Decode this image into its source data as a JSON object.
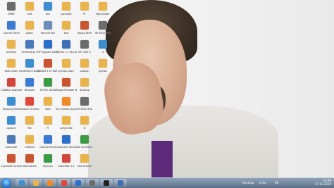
{
  "desktop_icons": [
    {
      "label": "HPBE",
      "color": "#6b6b6b"
    },
    {
      "label": "Control Panel",
      "color": "#3b7bd3"
    },
    {
      "label": "answers",
      "color": "#e9b44c"
    },
    {
      "label": "New folder",
      "color": "#e9b44c"
    },
    {
      "label": "CANDLE Aptitude",
      "color": "#d1473c"
    },
    {
      "label": "Shipping Rate",
      "color": "#3c8ed1"
    },
    {
      "label": "capture",
      "color": "#3c8ed1"
    },
    {
      "label": "Computer",
      "color": "#4a79b8"
    },
    {
      "label": "Cypress6 Screener",
      "color": "#c9542f"
    },
    {
      "label": "edit",
      "color": "#e9b44c"
    },
    {
      "label": "public",
      "color": "#e9b44c"
    },
    {
      "label": "Screenshot 1",
      "color": "#4a79b8"
    },
    {
      "label": "excited123 Download",
      "color": "#3c8ed1"
    },
    {
      "label": "Network",
      "color": "#3b7bd3"
    },
    {
      "label": "Google Chrome",
      "color": "#e0463a"
    },
    {
      "label": "file",
      "color": "#e9b44c"
    },
    {
      "label": "Untitled",
      "color": "#e9b44c"
    },
    {
      "label": "hibernation",
      "color": "#c9542f"
    },
    {
      "label": "SID",
      "color": "#3c8ed1"
    },
    {
      "label": "Recycle Bin",
      "color": "#6b8fb8"
    },
    {
      "label": "HP Support Assistant",
      "color": "#2a6fc9"
    },
    {
      "label": "INSIAM 1.0 HAIR 2.0",
      "color": "#c9542f"
    },
    {
      "label": "HOTEL XXXX",
      "color": "#3b9a45"
    },
    {
      "label": "note",
      "color": "#e9b44c"
    },
    {
      "label": "Pr",
      "color": "#e9b44c"
    },
    {
      "label": "Control Panel",
      "color": "#3b7bd3"
    },
    {
      "label": "SkyCam",
      "color": "#3b9a45"
    },
    {
      "label": "javanote",
      "color": "#e9b44c"
    },
    {
      "label": "test",
      "color": "#e9b44c"
    },
    {
      "label": "Python 3.7 (64-bit)",
      "color": "#3c6fb4"
    },
    {
      "label": "python.docx",
      "color": "#e9b44c"
    },
    {
      "label": "Reward Reader NC",
      "color": "#c9542f"
    },
    {
      "label": "VLC media player",
      "color": "#f08a24"
    },
    {
      "label": "script test",
      "color": "#e9b44c"
    },
    {
      "label": "CyberLink YouCam 10",
      "color": "#2a6fc9"
    },
    {
      "label": "StoreMan 1.4",
      "color": "#d1473c"
    },
    {
      "label": "Pr",
      "color": "#e9b44c"
    },
    {
      "label": "Happy Birth",
      "color": "#c9542f"
    },
    {
      "label": "IM 3000 X",
      "color": "#6b6b6b"
    },
    {
      "label": "session",
      "color": "#e9b44c"
    },
    {
      "label": "desktop",
      "color": "#e9b44c"
    },
    {
      "label": "IM 3000 XXX",
      "color": "#6b6b6b"
    },
    {
      "label": "D",
      "color": "#e9b44c"
    },
    {
      "label": "Ski Schedule",
      "color": "#3b9a45"
    },
    {
      "label": "new license",
      "color": "#e9b44c"
    },
    {
      "label": "New folder",
      "color": "#e9b44c"
    },
    {
      "label": "IM 3000 XXX",
      "color": "#6b6b6b"
    },
    {
      "label": "4",
      "color": "#3c8ed1"
    },
    {
      "label": "python",
      "color": "#e9b44c"
    }
  ],
  "taskbar": {
    "apps": [
      {
        "name": "internet-explorer",
        "color": "#3c8ed1"
      },
      {
        "name": "file-explorer",
        "color": "#e9b44c"
      },
      {
        "name": "media-player",
        "color": "#f08a24"
      },
      {
        "name": "chrome",
        "color": "#e0463a"
      },
      {
        "name": "vscode",
        "color": "#2a6fc9"
      },
      {
        "name": "photo-app",
        "color": "#6b6b6b"
      },
      {
        "name": "terminal",
        "color": "#222222"
      },
      {
        "name": "display",
        "color": "#3c6fb4"
      }
    ],
    "tray": {
      "desktop_label": "Desktop",
      "links_label": "Links",
      "lang": "EN",
      "time": "18:49",
      "date": "17-10-2019"
    }
  }
}
